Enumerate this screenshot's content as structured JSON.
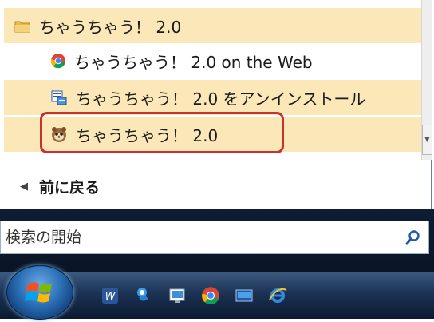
{
  "start_menu": {
    "folder": {
      "label": "ちゃうちゃう！ 2.0",
      "icon": "folder-icon"
    },
    "items": [
      {
        "label": "ちゃうちゃう！ 2.0 on the Web",
        "icon": "chrome-icon"
      },
      {
        "label": "ちゃうちゃう！ 2.0 をアンインストール",
        "icon": "uninstall-icon"
      },
      {
        "label": "ちゃうちゃう！ 2.0",
        "icon": "tanuki-icon"
      }
    ],
    "back_label": "前に戻る",
    "search_placeholder": "検索の開始"
  },
  "taskbar": {
    "quick_launch": [
      "word-icon",
      "messenger-icon",
      "show-desktop-icon",
      "chrome-icon",
      "switch-windows-icon",
      "ie-icon"
    ]
  },
  "colors": {
    "highlight": "#fbe7b7",
    "selection_outline": "#c9312e",
    "taskbar": "#1c3355"
  }
}
